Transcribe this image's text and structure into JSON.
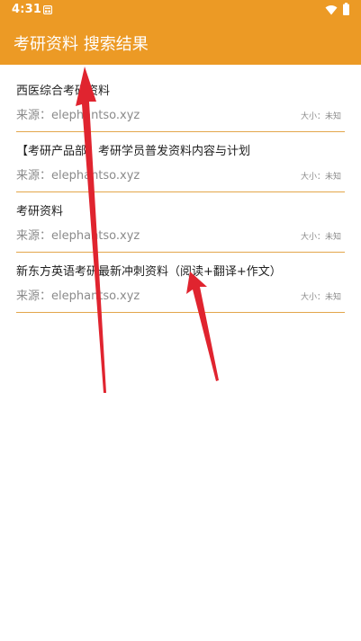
{
  "status_bar": {
    "time": "4:31",
    "icons": [
      "notification-icon",
      "wifi-icon",
      "battery-icon"
    ]
  },
  "header": {
    "title": "考研资料 搜索结果"
  },
  "results": [
    {
      "title": "西医综合考研资料",
      "source": "来源：elephantso.xyz",
      "size": "大小：未知"
    },
    {
      "title": "【考研产品部】考研学员普发资料内容与计划",
      "source": "来源：elephantso.xyz",
      "size": "大小：未知"
    },
    {
      "title": "考研资料",
      "source": "来源：elephantso.xyz",
      "size": "大小：未知"
    },
    {
      "title": "新东方英语考研最新冲刺资料（阅读+翻译+作文）",
      "source": "来源：elephantso.xyz",
      "size": "大小：未知"
    }
  ],
  "colors": {
    "accent": "#ec9a25",
    "divider": "#e3a64b",
    "title_text": "#1f1f1f",
    "secondary_text": "#8b8b8b",
    "annotation_arrow": "#e0242f"
  }
}
